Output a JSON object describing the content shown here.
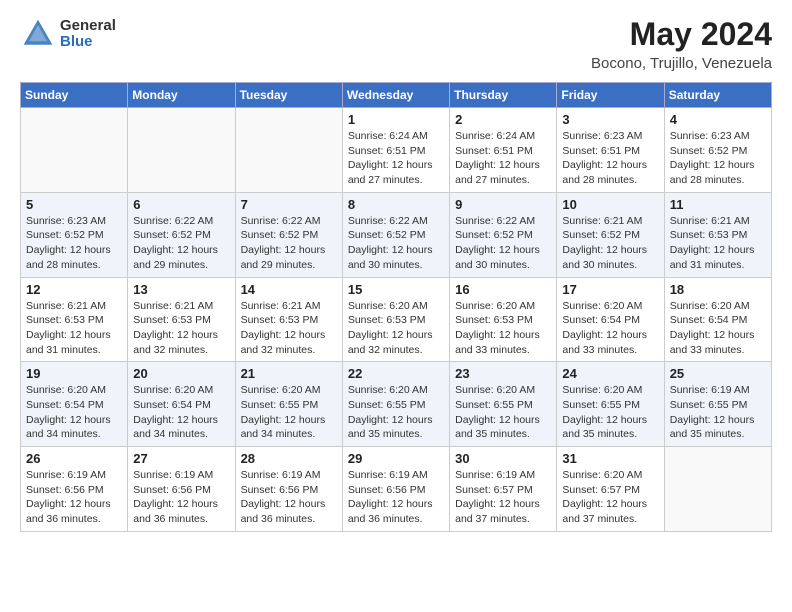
{
  "header": {
    "logo": {
      "general": "General",
      "blue": "Blue"
    },
    "title": "May 2024",
    "location": "Bocono, Trujillo, Venezuela"
  },
  "calendar": {
    "days": [
      "Sunday",
      "Monday",
      "Tuesday",
      "Wednesday",
      "Thursday",
      "Friday",
      "Saturday"
    ],
    "weeks": [
      {
        "cells": [
          {
            "date": "",
            "info": ""
          },
          {
            "date": "",
            "info": ""
          },
          {
            "date": "",
            "info": ""
          },
          {
            "date": "1",
            "info": "Sunrise: 6:24 AM\nSunset: 6:51 PM\nDaylight: 12 hours\nand 27 minutes."
          },
          {
            "date": "2",
            "info": "Sunrise: 6:24 AM\nSunset: 6:51 PM\nDaylight: 12 hours\nand 27 minutes."
          },
          {
            "date": "3",
            "info": "Sunrise: 6:23 AM\nSunset: 6:51 PM\nDaylight: 12 hours\nand 28 minutes."
          },
          {
            "date": "4",
            "info": "Sunrise: 6:23 AM\nSunset: 6:52 PM\nDaylight: 12 hours\nand 28 minutes."
          }
        ]
      },
      {
        "cells": [
          {
            "date": "5",
            "info": "Sunrise: 6:23 AM\nSunset: 6:52 PM\nDaylight: 12 hours\nand 28 minutes."
          },
          {
            "date": "6",
            "info": "Sunrise: 6:22 AM\nSunset: 6:52 PM\nDaylight: 12 hours\nand 29 minutes."
          },
          {
            "date": "7",
            "info": "Sunrise: 6:22 AM\nSunset: 6:52 PM\nDaylight: 12 hours\nand 29 minutes."
          },
          {
            "date": "8",
            "info": "Sunrise: 6:22 AM\nSunset: 6:52 PM\nDaylight: 12 hours\nand 30 minutes."
          },
          {
            "date": "9",
            "info": "Sunrise: 6:22 AM\nSunset: 6:52 PM\nDaylight: 12 hours\nand 30 minutes."
          },
          {
            "date": "10",
            "info": "Sunrise: 6:21 AM\nSunset: 6:52 PM\nDaylight: 12 hours\nand 30 minutes."
          },
          {
            "date": "11",
            "info": "Sunrise: 6:21 AM\nSunset: 6:53 PM\nDaylight: 12 hours\nand 31 minutes."
          }
        ]
      },
      {
        "cells": [
          {
            "date": "12",
            "info": "Sunrise: 6:21 AM\nSunset: 6:53 PM\nDaylight: 12 hours\nand 31 minutes."
          },
          {
            "date": "13",
            "info": "Sunrise: 6:21 AM\nSunset: 6:53 PM\nDaylight: 12 hours\nand 32 minutes."
          },
          {
            "date": "14",
            "info": "Sunrise: 6:21 AM\nSunset: 6:53 PM\nDaylight: 12 hours\nand 32 minutes."
          },
          {
            "date": "15",
            "info": "Sunrise: 6:20 AM\nSunset: 6:53 PM\nDaylight: 12 hours\nand 32 minutes."
          },
          {
            "date": "16",
            "info": "Sunrise: 6:20 AM\nSunset: 6:53 PM\nDaylight: 12 hours\nand 33 minutes."
          },
          {
            "date": "17",
            "info": "Sunrise: 6:20 AM\nSunset: 6:54 PM\nDaylight: 12 hours\nand 33 minutes."
          },
          {
            "date": "18",
            "info": "Sunrise: 6:20 AM\nSunset: 6:54 PM\nDaylight: 12 hours\nand 33 minutes."
          }
        ]
      },
      {
        "cells": [
          {
            "date": "19",
            "info": "Sunrise: 6:20 AM\nSunset: 6:54 PM\nDaylight: 12 hours\nand 34 minutes."
          },
          {
            "date": "20",
            "info": "Sunrise: 6:20 AM\nSunset: 6:54 PM\nDaylight: 12 hours\nand 34 minutes."
          },
          {
            "date": "21",
            "info": "Sunrise: 6:20 AM\nSunset: 6:55 PM\nDaylight: 12 hours\nand 34 minutes."
          },
          {
            "date": "22",
            "info": "Sunrise: 6:20 AM\nSunset: 6:55 PM\nDaylight: 12 hours\nand 35 minutes."
          },
          {
            "date": "23",
            "info": "Sunrise: 6:20 AM\nSunset: 6:55 PM\nDaylight: 12 hours\nand 35 minutes."
          },
          {
            "date": "24",
            "info": "Sunrise: 6:20 AM\nSunset: 6:55 PM\nDaylight: 12 hours\nand 35 minutes."
          },
          {
            "date": "25",
            "info": "Sunrise: 6:19 AM\nSunset: 6:55 PM\nDaylight: 12 hours\nand 35 minutes."
          }
        ]
      },
      {
        "cells": [
          {
            "date": "26",
            "info": "Sunrise: 6:19 AM\nSunset: 6:56 PM\nDaylight: 12 hours\nand 36 minutes."
          },
          {
            "date": "27",
            "info": "Sunrise: 6:19 AM\nSunset: 6:56 PM\nDaylight: 12 hours\nand 36 minutes."
          },
          {
            "date": "28",
            "info": "Sunrise: 6:19 AM\nSunset: 6:56 PM\nDaylight: 12 hours\nand 36 minutes."
          },
          {
            "date": "29",
            "info": "Sunrise: 6:19 AM\nSunset: 6:56 PM\nDaylight: 12 hours\nand 36 minutes."
          },
          {
            "date": "30",
            "info": "Sunrise: 6:19 AM\nSunset: 6:57 PM\nDaylight: 12 hours\nand 37 minutes."
          },
          {
            "date": "31",
            "info": "Sunrise: 6:20 AM\nSunset: 6:57 PM\nDaylight: 12 hours\nand 37 minutes."
          },
          {
            "date": "",
            "info": ""
          }
        ]
      }
    ]
  }
}
